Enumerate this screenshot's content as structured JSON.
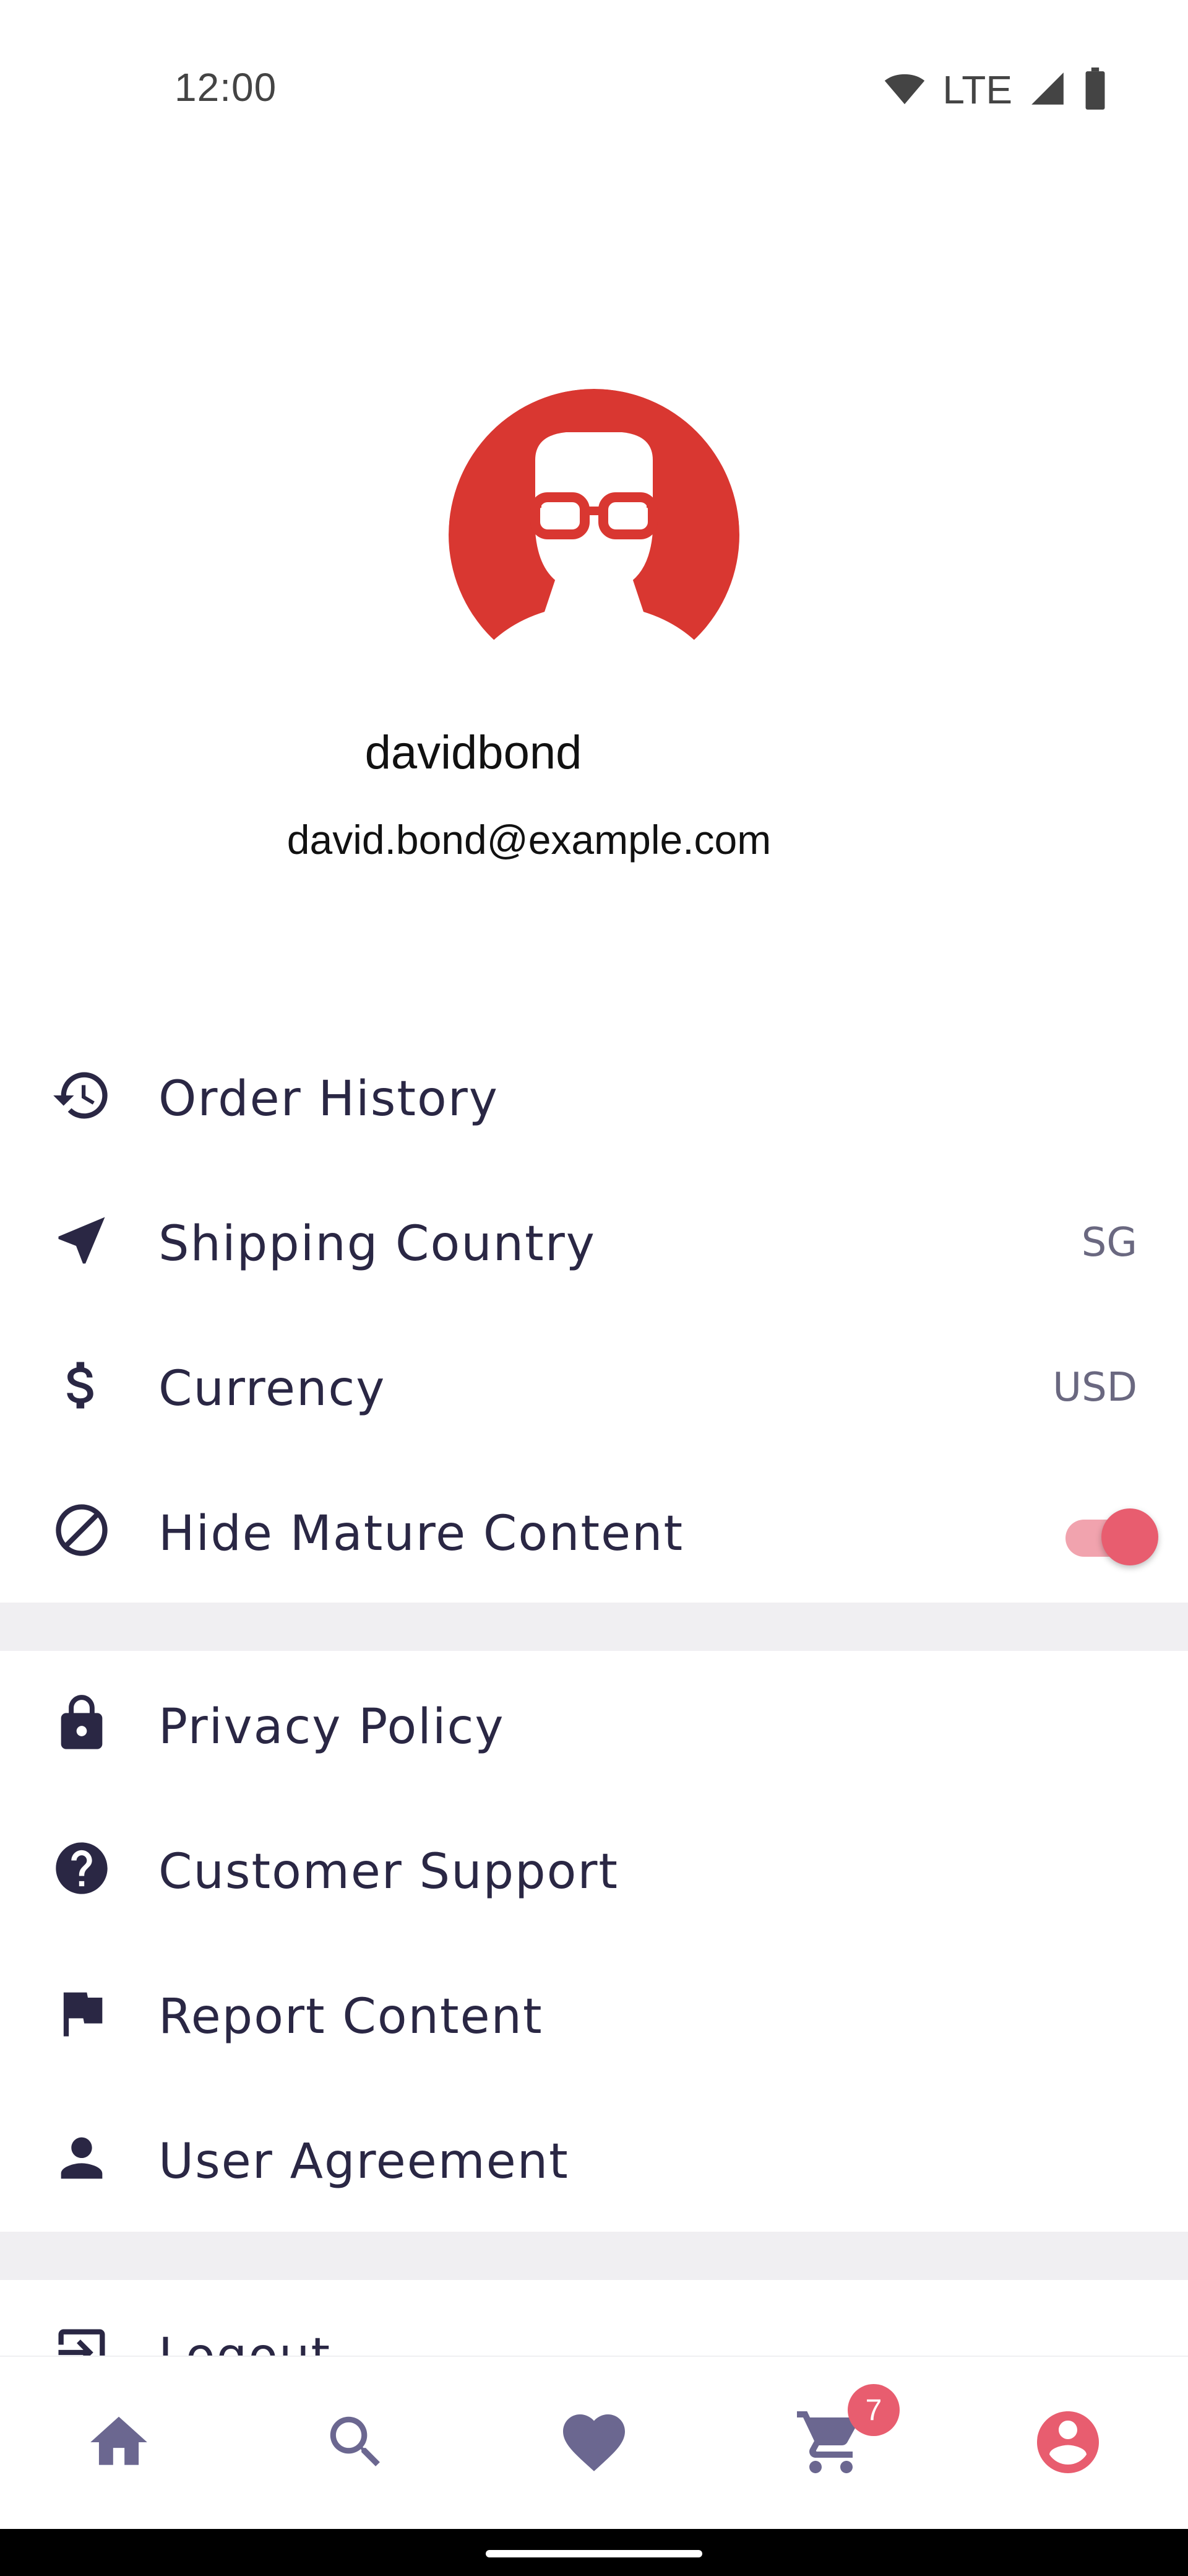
{
  "status_bar": {
    "time": "12:00",
    "network": "LTE",
    "icons": [
      "wifi-icon",
      "signal-icon",
      "battery-icon"
    ]
  },
  "profile": {
    "username": "davidbond",
    "email": "david.bond@example.com",
    "avatar_color": "#d93731"
  },
  "menu": {
    "order_history": {
      "label": "Order History",
      "icon": "history-icon"
    },
    "shipping_country": {
      "label": "Shipping Country",
      "value": "SG",
      "icon": "navigation-arrow-icon"
    },
    "currency": {
      "label": "Currency",
      "value": "USD",
      "icon": "dollar-icon"
    },
    "hide_mature": {
      "label": "Hide Mature Content",
      "icon": "block-icon",
      "enabled": true
    },
    "privacy_policy": {
      "label": "Privacy Policy",
      "icon": "lock-icon"
    },
    "customer_support": {
      "label": "Customer Support",
      "icon": "help-icon"
    },
    "report_content": {
      "label": "Report Content",
      "icon": "flag-icon"
    },
    "user_agreement": {
      "label": "User Agreement",
      "icon": "person-icon"
    },
    "logout": {
      "label": "Logout",
      "icon": "logout-icon"
    }
  },
  "bottom_nav": {
    "items": [
      "home-icon",
      "search-icon",
      "heart-icon",
      "cart-icon",
      "account-icon"
    ],
    "cart_count": "7",
    "active": "account-icon",
    "colors": {
      "inactive": "#6b6790",
      "active": "#e85d6f"
    }
  }
}
